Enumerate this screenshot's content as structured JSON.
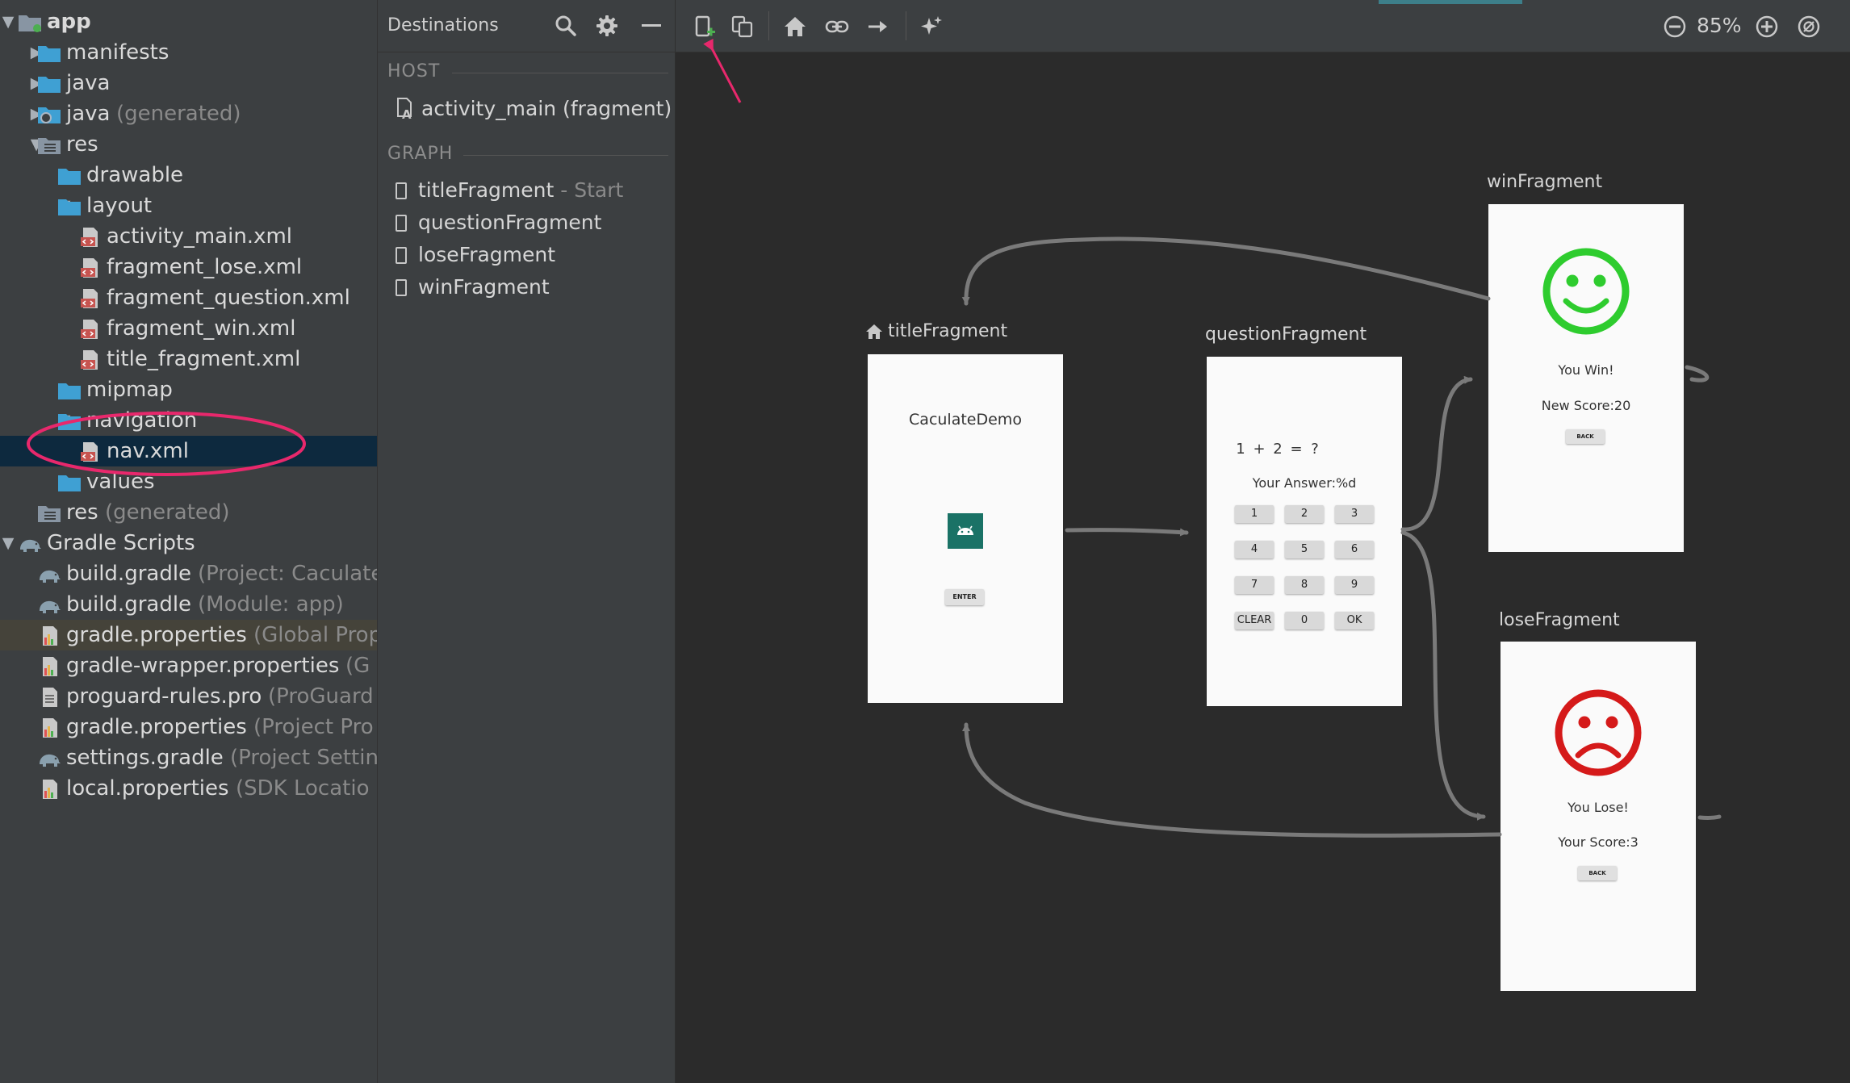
{
  "tree": [
    {
      "label": "app",
      "hint": "",
      "icon": "app-module-icon",
      "arrow": "down",
      "bold": true
    },
    {
      "label": "manifests",
      "hint": "",
      "icon": "folder-icon",
      "arrow": "right"
    },
    {
      "label": "java",
      "hint": "",
      "icon": "folder-icon",
      "arrow": "right"
    },
    {
      "label": "java",
      "hint": "(generated)",
      "icon": "generated-folder-icon",
      "arrow": "right"
    },
    {
      "label": "res",
      "hint": "",
      "icon": "res-folder-icon",
      "arrow": "down"
    },
    {
      "label": "drawable",
      "hint": "",
      "icon": "folder-icon",
      "arrow": "right"
    },
    {
      "label": "layout",
      "hint": "",
      "icon": "folder-icon",
      "arrow": "down"
    },
    {
      "label": "activity_main.xml",
      "hint": "",
      "icon": "xml-file-icon",
      "arrow": ""
    },
    {
      "label": "fragment_lose.xml",
      "hint": "",
      "icon": "xml-file-icon",
      "arrow": ""
    },
    {
      "label": "fragment_question.xml",
      "hint": "",
      "icon": "xml-file-icon",
      "arrow": ""
    },
    {
      "label": "fragment_win.xml",
      "hint": "",
      "icon": "xml-file-icon",
      "arrow": ""
    },
    {
      "label": "title_fragment.xml",
      "hint": "",
      "icon": "xml-file-icon",
      "arrow": ""
    },
    {
      "label": "mipmap",
      "hint": "",
      "icon": "folder-icon",
      "arrow": "right"
    },
    {
      "label": "navigation",
      "hint": "",
      "icon": "folder-icon",
      "arrow": "down"
    },
    {
      "label": "nav.xml",
      "hint": "",
      "icon": "xml-file-icon",
      "arrow": ""
    },
    {
      "label": "values",
      "hint": "",
      "icon": "folder-icon",
      "arrow": "right"
    },
    {
      "label": "res",
      "hint": "(generated)",
      "icon": "res-folder-icon",
      "arrow": ""
    },
    {
      "label": "Gradle Scripts",
      "hint": "",
      "icon": "gradle-elephant-icon",
      "arrow": "down"
    },
    {
      "label": "build.gradle",
      "hint": "(Project: Caculate",
      "icon": "gradle-elephant-icon",
      "arrow": ""
    },
    {
      "label": "build.gradle",
      "hint": "(Module: app)",
      "icon": "gradle-elephant-icon",
      "arrow": ""
    },
    {
      "label": "gradle.properties",
      "hint": "(Global Prop",
      "icon": "properties-file-icon",
      "arrow": ""
    },
    {
      "label": "gradle-wrapper.properties",
      "hint": "(G",
      "icon": "properties-file-icon",
      "arrow": ""
    },
    {
      "label": "proguard-rules.pro",
      "hint": "(ProGuard",
      "icon": "text-file-icon",
      "arrow": ""
    },
    {
      "label": "gradle.properties",
      "hint": "(Project Pro",
      "icon": "properties-file-icon",
      "arrow": ""
    },
    {
      "label": "settings.gradle",
      "hint": "(Project Settin",
      "icon": "gradle-elephant-icon",
      "arrow": ""
    },
    {
      "label": "local.properties",
      "hint": "(SDK Locatio",
      "icon": "properties-file-icon",
      "arrow": ""
    }
  ],
  "destinations": {
    "title": "Destinations",
    "host_header": "HOST",
    "host_item": "activity_main (fragment)",
    "graph_header": "GRAPH",
    "items": [
      {
        "label": "titleFragment",
        "hint": " - Start"
      },
      {
        "label": "questionFragment",
        "hint": ""
      },
      {
        "label": "loseFragment",
        "hint": ""
      },
      {
        "label": "winFragment",
        "hint": ""
      }
    ]
  },
  "toolbar": {
    "zoom": "85%"
  },
  "graph": {
    "title": {
      "label": "titleFragment",
      "app_name": "CaculateDemo",
      "button": "ENTER"
    },
    "question": {
      "label": "questionFragment",
      "equation": [
        "1",
        "+",
        "2",
        "=",
        "?"
      ],
      "answer": "Your Answer:%d",
      "keys": [
        [
          "1",
          "2",
          "3"
        ],
        [
          "4",
          "5",
          "6"
        ],
        [
          "7",
          "8",
          "9"
        ],
        [
          "CLEAR",
          "0",
          "OK"
        ]
      ]
    },
    "win": {
      "label": "winFragment",
      "message": "You Win!",
      "score": "New Score:20",
      "button": "BACK"
    },
    "lose": {
      "label": "loseFragment",
      "message": "You Lose!",
      "score": "Your Score:3",
      "button": "BACK"
    }
  },
  "colors": {
    "annotation": "#e8286c",
    "win_face": "#2ecc2e",
    "lose_face": "#d51a1a",
    "selected_row": "#0d293e",
    "arrow": "#7a7a7a",
    "android_icon_bg": "#1a7266"
  }
}
